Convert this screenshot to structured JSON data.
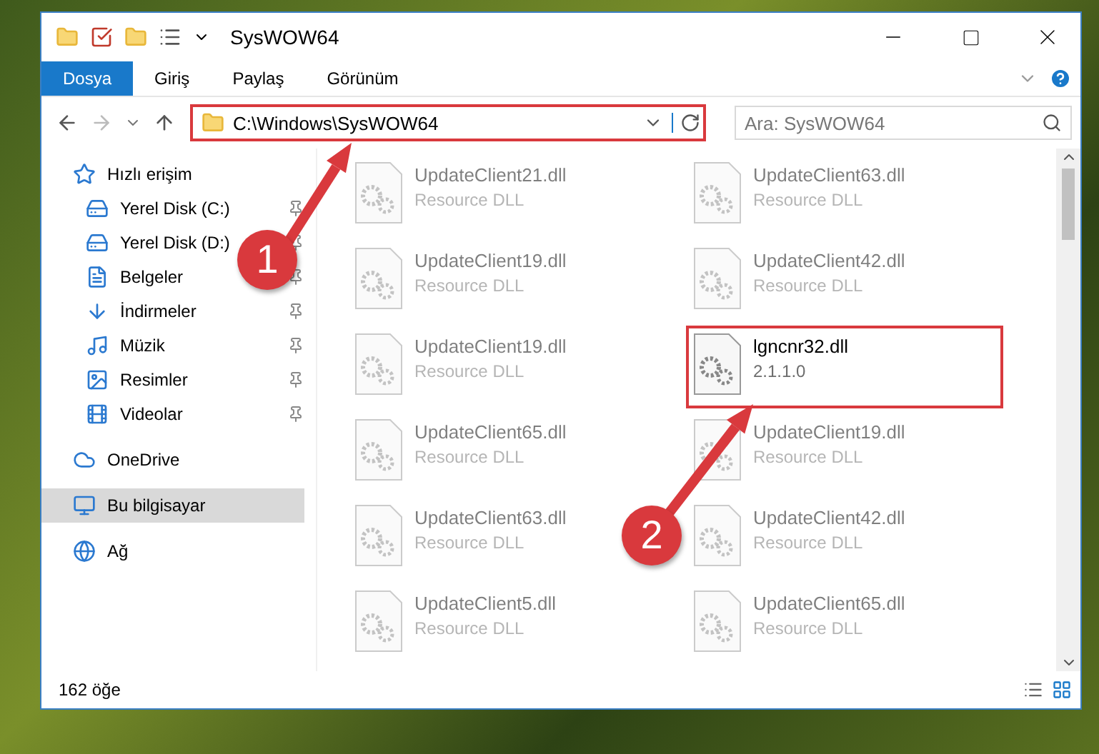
{
  "window": {
    "title": "SysWOW64"
  },
  "ribbon_tabs": [
    {
      "label": "Dosya",
      "selected": true
    },
    {
      "label": "Giriş",
      "selected": false
    },
    {
      "label": "Paylaş",
      "selected": false
    },
    {
      "label": "Görünüm",
      "selected": false
    }
  ],
  "address": {
    "path": "C:\\Windows\\SysWOW64",
    "highlighted": true
  },
  "search": {
    "placeholder": "Ara: SysWOW64"
  },
  "sidebar": {
    "items": [
      {
        "label": "Hızlı erişim",
        "selected": false,
        "children": [
          {
            "label": "Yerel Disk (C:)",
            "selected": false,
            "pinned": true
          },
          {
            "label": "Yerel Disk (D:)",
            "selected": false,
            "pinned": true
          },
          {
            "label": "Belgeler",
            "selected": false,
            "pinned": true
          },
          {
            "label": "İndirmeler",
            "selected": false,
            "pinned": true
          },
          {
            "label": "Müzik",
            "selected": false,
            "pinned": true
          },
          {
            "label": "Resimler",
            "selected": false,
            "pinned": true
          },
          {
            "label": "Videolar",
            "selected": false,
            "pinned": true
          }
        ]
      },
      {
        "label": "OneDrive",
        "selected": false
      },
      {
        "label": "Bu bilgisayar",
        "selected": true
      },
      {
        "label": "Ağ",
        "selected": false
      }
    ]
  },
  "files": [
    {
      "name": "UpdateClient21.dll",
      "detail": "Resource DLL",
      "faded": true,
      "highlighted": false
    },
    {
      "name": "UpdateClient63.dll",
      "detail": "Resource DLL",
      "faded": true,
      "highlighted": false
    },
    {
      "name": "UpdateClient19.dll",
      "detail": "Resource DLL",
      "faded": true,
      "highlighted": false
    },
    {
      "name": "UpdateClient42.dll",
      "detail": "Resource DLL",
      "faded": true,
      "highlighted": false
    },
    {
      "name": "UpdateClient19.dll",
      "detail": "Resource DLL",
      "faded": true,
      "highlighted": false
    },
    {
      "name": "lgncnr32.dll",
      "detail": "2.1.1.0",
      "faded": false,
      "highlighted": true
    },
    {
      "name": "UpdateClient65.dll",
      "detail": "Resource DLL",
      "faded": true,
      "highlighted": false
    },
    {
      "name": "UpdateClient19.dll",
      "detail": "Resource DLL",
      "faded": true,
      "highlighted": false
    },
    {
      "name": "UpdateClient63.dll",
      "detail": "Resource DLL",
      "faded": true,
      "highlighted": false
    },
    {
      "name": "UpdateClient42.dll",
      "detail": "Resource DLL",
      "faded": true,
      "highlighted": false
    },
    {
      "name": "UpdateClient5.dll",
      "detail": "Resource DLL",
      "faded": true,
      "highlighted": false
    },
    {
      "name": "UpdateClient65.dll",
      "detail": "Resource DLL",
      "faded": true,
      "highlighted": false
    }
  ],
  "status_bar": {
    "count": "162 öğe"
  },
  "callouts": [
    {
      "number": "1"
    },
    {
      "number": "2"
    }
  ]
}
